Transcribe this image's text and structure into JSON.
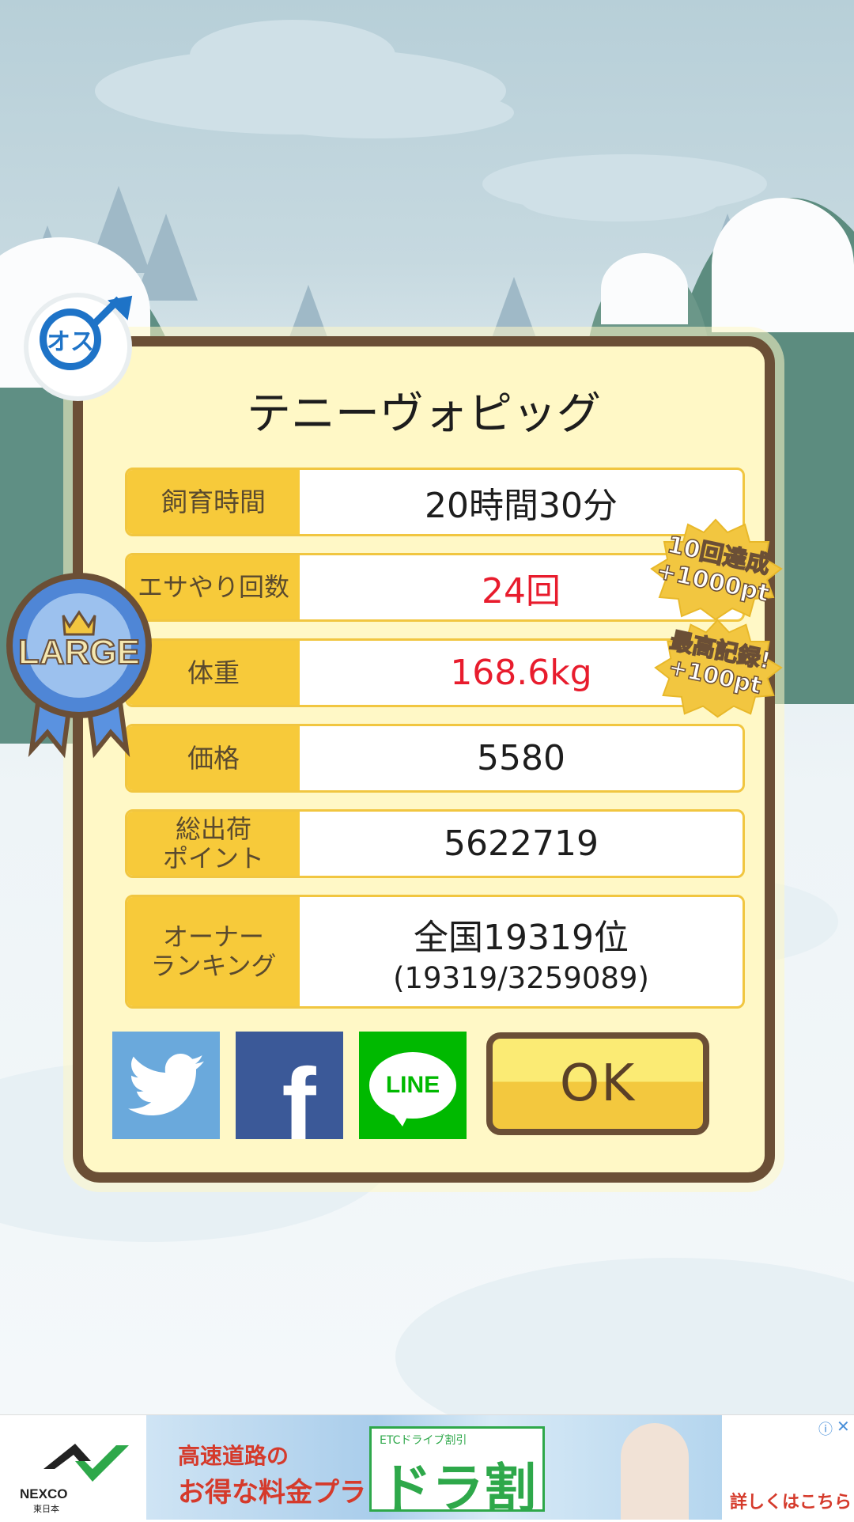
{
  "pig": {
    "name": "テニーヴォピッグ",
    "gender_label": "オス",
    "size_badge": "LARGE"
  },
  "stats": [
    {
      "label": "飼育時間",
      "value": "20時間30分",
      "highlight": false
    },
    {
      "label": "エサやり回数",
      "value": "24回",
      "highlight": true
    },
    {
      "label": "体重",
      "value": "168.6kg",
      "highlight": true
    },
    {
      "label": "価格",
      "value": "5580",
      "highlight": false
    },
    {
      "label": "総出荷\nポイント",
      "value": "5622719",
      "highlight": false
    },
    {
      "label": "オーナー\nランキング",
      "value": "全国19319位",
      "value_sub": "(19319/3259089)",
      "highlight": false
    }
  ],
  "achievements": [
    {
      "line1": "10回達成",
      "line2": "+1000pt"
    },
    {
      "line1": "最高記録!",
      "line2": "+100pt"
    }
  ],
  "buttons": {
    "twitter": "twitter-icon",
    "facebook": "f",
    "line": "LINE",
    "ok": "OK"
  },
  "ad": {
    "brand": "NEXCO",
    "brand_sub": "東日本",
    "headline1": "高速道路の",
    "headline2": "お得な料金プラン",
    "tag": "ETCドライブ割引",
    "big_text": "ドラ割",
    "cta": "詳しくはこちら"
  },
  "colors": {
    "frame": "#6b4f36",
    "card_bg": "#fff8c6",
    "label_bg": "#f7ca3a",
    "highlight_text": "#e81c2d",
    "twitter": "#6aa9dc",
    "facebook": "#3b5998",
    "line": "#00b900"
  }
}
